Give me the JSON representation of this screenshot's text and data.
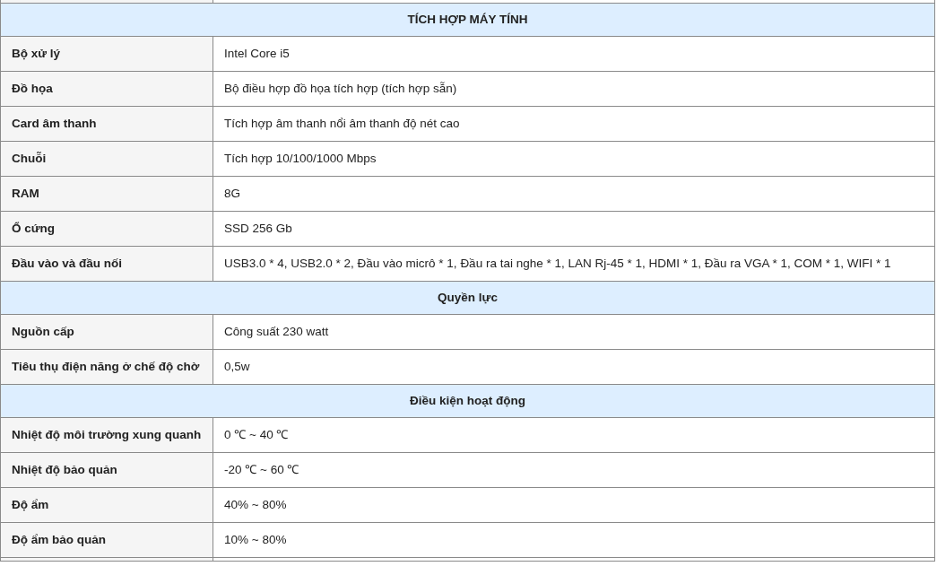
{
  "sections": [
    {
      "title": "TÍCH HỢP MÁY TÍNH",
      "rows": [
        {
          "label": "Bộ xử lý",
          "value": "Intel Core i5"
        },
        {
          "label": "Đồ họa",
          "value": "Bộ điều hợp đồ họa tích hợp (tích hợp sẵn)"
        },
        {
          "label": "Card âm thanh",
          "value": "Tích hợp âm thanh nổi âm thanh độ nét cao"
        },
        {
          "label": "Chuỗi",
          "value": "Tích hợp 10/100/1000 Mbps"
        },
        {
          "label": "RAM",
          "value": "8G"
        },
        {
          "label": "Ổ cứng",
          "value": "SSD 256 Gb"
        },
        {
          "label": "Đầu vào và đầu nối",
          "value": "USB3.0 * 4, USB2.0 * 2, Đầu vào micrô * 1, Đầu ra tai nghe * 1, LAN Rj-45 * 1, HDMI * 1, Đầu ra VGA * 1, COM * 1, WIFI * 1"
        }
      ]
    },
    {
      "title": "Quyền lực",
      "rows": [
        {
          "label": "Nguồn cấp",
          "value": "Công suất 230 watt"
        },
        {
          "label": "Tiêu thụ điện năng ở chế độ chờ",
          "value": "0,5w"
        }
      ]
    },
    {
      "title": "Điều kiện hoạt động",
      "rows": [
        {
          "label": "Nhiệt độ môi trường xung quanh",
          "value": "0 ℃ ~ 40 ℃"
        },
        {
          "label": "Nhiệt độ bảo quản",
          "value": "-20 ℃ ~ 60 ℃"
        },
        {
          "label": "Độ ẩm",
          "value": "40% ~ 80%"
        },
        {
          "label": "Độ ẩm bảo quản",
          "value": "10% ~ 80%"
        }
      ]
    }
  ]
}
